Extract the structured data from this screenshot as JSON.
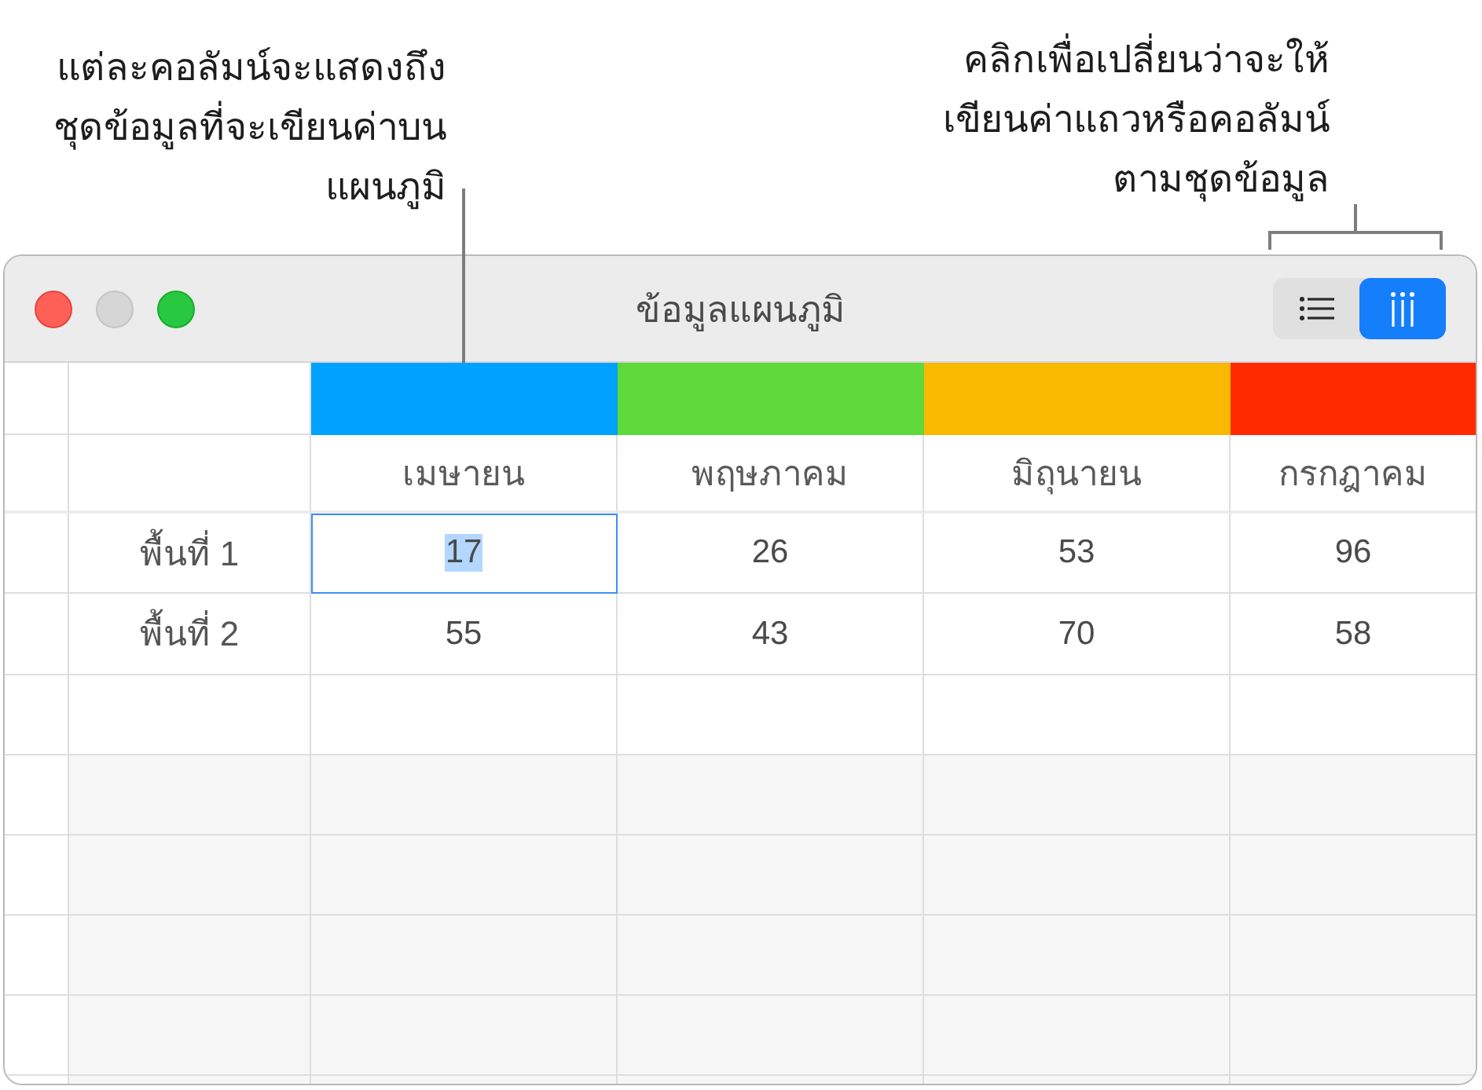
{
  "callouts": [
    {
      "kind": "line",
      "lines": [
        "แต่ละคอลัมน์จะแสดงถึง",
        "ชุดข้อมูลที่จะเขียนค่าบน",
        "แผนภูมิ"
      ]
    },
    {
      "kind": "bracket",
      "lines": [
        "คลิกเพื่อเปลี่ยนว่าจะให้",
        "เขียนค่าแถวหรือคอลัมน์",
        "ตามชุดข้อมูล"
      ]
    }
  ],
  "window": {
    "title": "ข้อมูลแผนภูมิ",
    "view_toggle": [
      {
        "kind": "list",
        "selected": false
      },
      {
        "kind": "columns",
        "selected": true
      }
    ]
  },
  "table": {
    "series": [
      {
        "name": "เมษายน",
        "color": "#00a2ff"
      },
      {
        "name": "พฤษภาคม",
        "color": "#5fd93a"
      },
      {
        "name": "มิถุนายน",
        "color": "#f8b900"
      },
      {
        "name": "กรกฎาคม",
        "color": "#ff2a00"
      }
    ],
    "rows": [
      {
        "label": "พื้นที่ 1",
        "cells": [
          {
            "value": "17",
            "selected": true
          },
          {
            "value": "26",
            "selected": false
          },
          {
            "value": "53",
            "selected": false
          },
          {
            "value": "96",
            "selected": false
          }
        ]
      },
      {
        "label": "พื้นที่ 2",
        "cells": [
          {
            "value": "55",
            "selected": false
          },
          {
            "value": "43",
            "selected": false
          },
          {
            "value": "70",
            "selected": false
          },
          {
            "value": "58",
            "selected": false
          }
        ]
      }
    ]
  }
}
